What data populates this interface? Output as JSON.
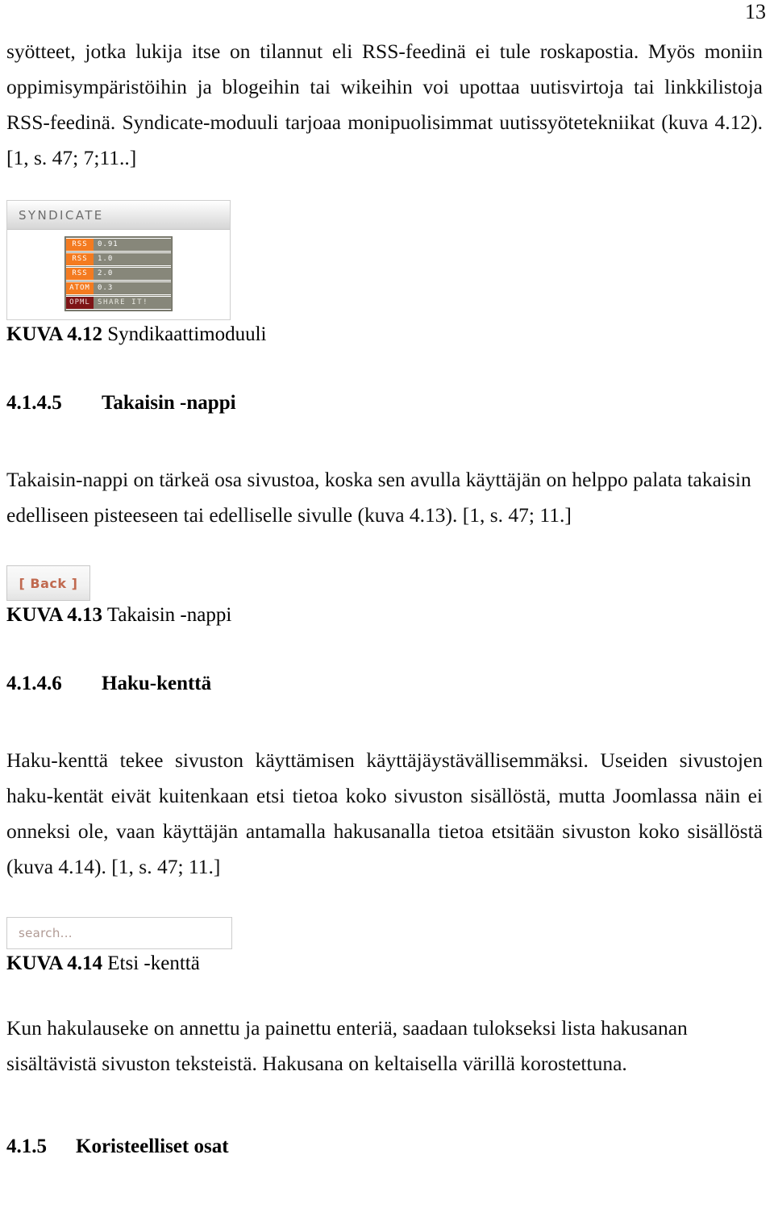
{
  "page": {
    "number": "13"
  },
  "paragraphs": {
    "intro": "syötteet, jotka lukija itse on tilannut eli RSS-feedinä ei tule roskapostia. Myös moniin oppimisympäristöihin ja blogeihin tai wikeihin voi upottaa uutisvirtoja tai linkkilistoja RSS-feedinä. Syndicate-moduuli tarjoaa monipuolisimmat uutissyötetekniikat (kuva 4.12). [1, s. 47; 7;11..]",
    "back_button": "Takaisin-nappi on tärkeä osa sivustoa, koska sen avulla käyttäjän on helppo palata takaisin edelliseen pisteeseen tai edelliselle sivulle (kuva 4.13). [1, s. 47; 11.]",
    "search_field": "Haku-kenttä tekee sivuston käyttämisen käyttäjäystävällisemmäksi. Useiden sivustojen haku-kentät eivät kuitenkaan etsi tietoa koko sivuston sisällöstä, mutta Joomlassa näin ei onneksi ole, vaan käyttäjän antamalla hakusanalla tietoa etsitään sivuston koko sisällöstä (kuva 4.14). [1, s. 47; 11.]",
    "search_results": "Kun hakulauseke on annettu ja painettu enteriä, saadaan tulokseksi lista hakusanan sisältävistä sivuston teksteistä. Hakusana on keltaisella värillä korostettuna."
  },
  "figures": {
    "syndicate": {
      "caption_label": "KUVA 4.12",
      "caption_text": " Syndikaattimoduuli",
      "module_title": "SYNDICATE",
      "rows": [
        {
          "tag": "RSS",
          "version": "0.91"
        },
        {
          "tag": "RSS",
          "version": "1.0"
        },
        {
          "tag": "RSS",
          "version": "2.0"
        },
        {
          "tag": "ATOM",
          "version": "0.3"
        },
        {
          "tag": "OPML",
          "version": "SHARE IT!"
        }
      ],
      "colors": {
        "tag_background": "#f47b20",
        "opml_background": "#7e1416",
        "row_background": "#87877a",
        "header_text": "#6d6d6d"
      }
    },
    "back_button": {
      "caption_label": "KUVA 4.13",
      "caption_text": " Takaisin -nappi",
      "button_label": "[ Back ]",
      "colors": {
        "label": "#c0694f",
        "background": "#f1f1f1"
      }
    },
    "search_field": {
      "caption_label": "KUVA 4.14",
      "caption_text": " Etsi -kenttä",
      "placeholder": "search...",
      "value": "",
      "colors": {
        "placeholder": "#b09a94",
        "background": "#ffffff"
      }
    }
  },
  "headings": {
    "back_button": {
      "number": "4.1.4.5",
      "title": "Takaisin -nappi"
    },
    "search_field": {
      "number": "4.1.4.6",
      "title": "Haku-kenttä"
    },
    "decorative": {
      "number": "4.1.5",
      "title": "Koristeelliset osat"
    }
  }
}
